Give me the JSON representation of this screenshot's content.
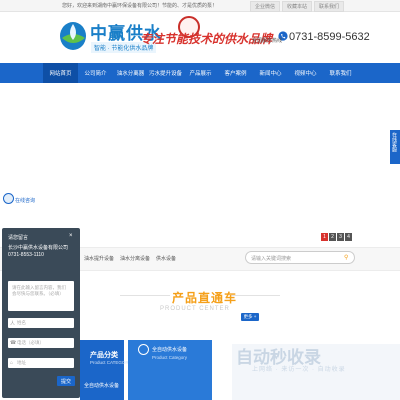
{
  "topbar": {
    "welcome": "您好，欢迎来到湖南中赢环保设备有限公司！节能的、才是优质的泵！",
    "links": [
      "企业微信",
      "收藏本站",
      "联系我们"
    ]
  },
  "header": {
    "logo_title": "中赢供水",
    "logo_sub": "智能 · 节能化供水品牌",
    "slogan": "专注节能技术的供水品牌",
    "hotline_label": "全国服务热线",
    "hotline": "0731-8599-5632"
  },
  "nav": {
    "items": [
      {
        "label": "网站首页",
        "active": true
      },
      {
        "label": "公司简介",
        "active": false
      },
      {
        "label": "油水分离器",
        "active": false
      },
      {
        "label": "污水提升设备",
        "active": false
      },
      {
        "label": "产品展示",
        "active": false
      },
      {
        "label": "客户案例",
        "active": false
      },
      {
        "label": "新闻中心",
        "active": false
      },
      {
        "label": "视频中心",
        "active": false
      },
      {
        "label": "联系我们",
        "active": false
      }
    ]
  },
  "banner": {
    "pages": [
      "1",
      "2",
      "3",
      "4"
    ],
    "active_page": "1"
  },
  "float": {
    "service": "在线客服",
    "qq": "在线咨询"
  },
  "message": {
    "title": "请您留言",
    "close": "×",
    "text": "长沙中赢供水设备有限公司0731-8553-1110",
    "area_placeholder": "请在此输入留言内容，我们会尽快与您联系。（必填）",
    "fields": [
      {
        "icon": "人",
        "placeholder": "姓名"
      },
      {
        "icon": "☎",
        "placeholder": "电话（必填）"
      },
      {
        "icon": "⌂",
        "placeholder": "地址"
      }
    ],
    "submit": "提交"
  },
  "categories": {
    "items": [
      "油水提升设备",
      "油水分离设备",
      "供水设备"
    ],
    "search_placeholder": "请输入关键词搜索"
  },
  "product_center": {
    "title": "产品直通车",
    "subtitle": "PRODUCT CENTER",
    "more": "更多 +",
    "cat_title": "产品分类",
    "cat_sub": "Product CATEGORY",
    "cat_item": "全自动供水设备",
    "card_title": "全自动供水设备",
    "card_sub": "Product Category"
  },
  "watermark": {
    "logo": "自动秒收录",
    "sub": "上网络 · 来访一次 · 自动收录"
  },
  "colors": {
    "primary": "#1b66c9",
    "accent": "#f5a01a",
    "slogan": "#d8322d"
  }
}
